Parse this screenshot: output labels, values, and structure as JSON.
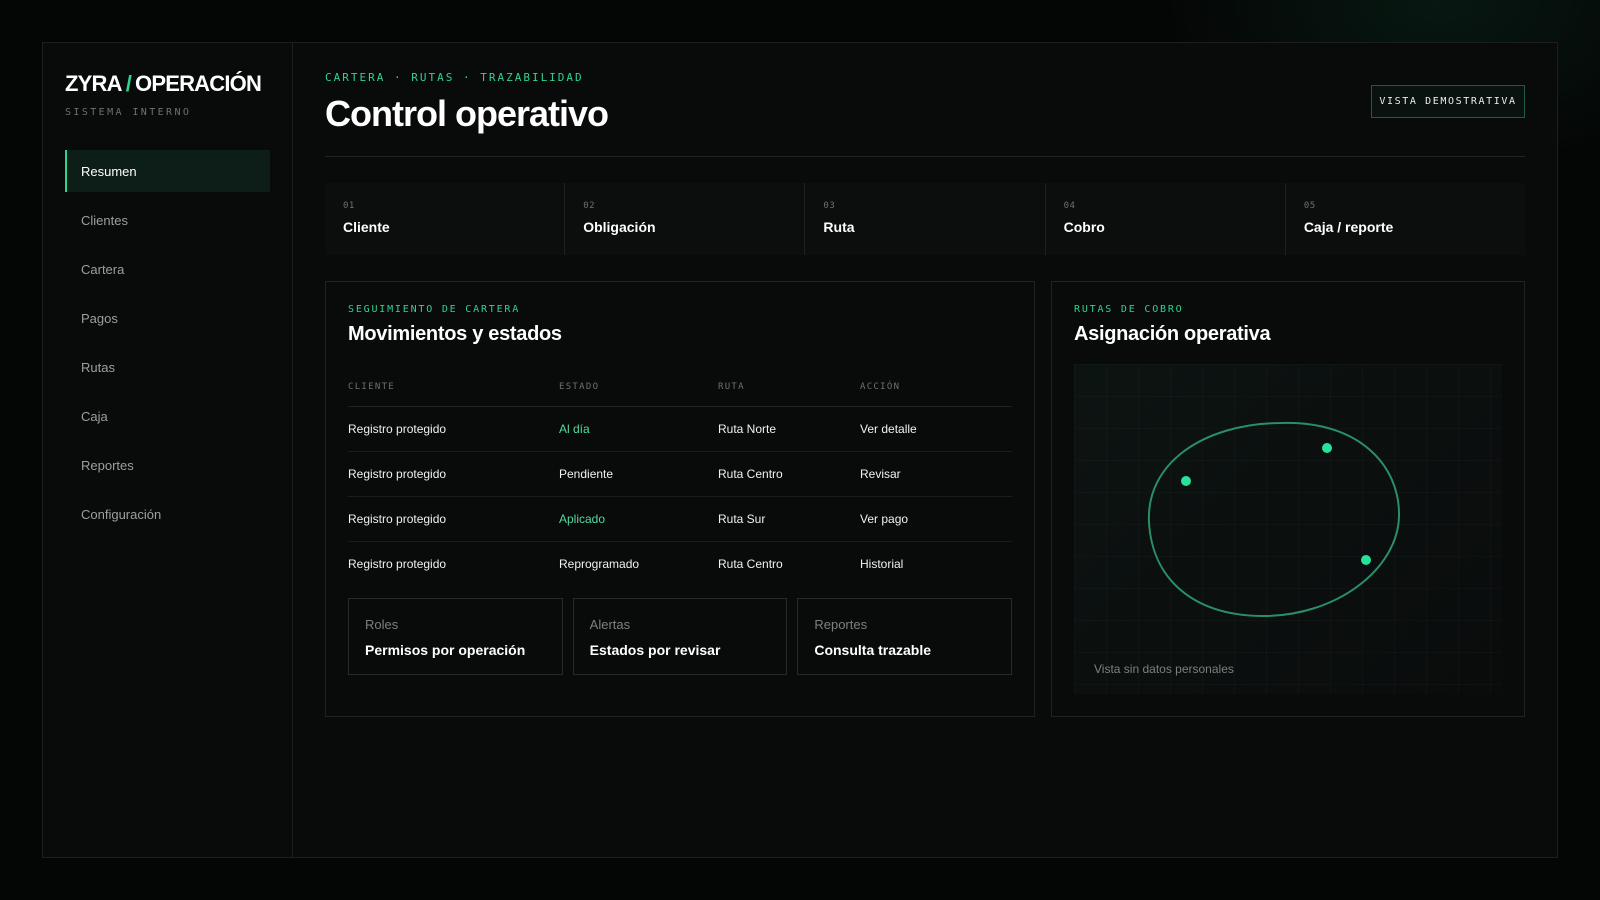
{
  "brand": {
    "name_left": "ZYRA",
    "slash": "/",
    "name_right": "OPERACIÓN",
    "subtitle": "SISTEMA INTERNO"
  },
  "sidebar": {
    "items": [
      {
        "label": "Resumen",
        "active": true
      },
      {
        "label": "Clientes"
      },
      {
        "label": "Cartera"
      },
      {
        "label": "Pagos"
      },
      {
        "label": "Rutas"
      },
      {
        "label": "Caja"
      },
      {
        "label": "Reportes"
      },
      {
        "label": "Configuración"
      }
    ]
  },
  "header": {
    "breadcrumb": "CARTERA · RUTAS · TRAZABILIDAD",
    "title": "Control operativo",
    "demo_button": "VISTA DEMOSTRATIVA"
  },
  "steps": [
    {
      "num": "01",
      "label": "Cliente"
    },
    {
      "num": "02",
      "label": "Obligación"
    },
    {
      "num": "03",
      "label": "Ruta"
    },
    {
      "num": "04",
      "label": "Cobro"
    },
    {
      "num": "05",
      "label": "Caja / reporte"
    }
  ],
  "tracking": {
    "eyebrow": "SEGUIMIENTO DE CARTERA",
    "title": "Movimientos y estados",
    "columns": [
      "CLIENTE",
      "ESTADO",
      "RUTA",
      "ACCIÓN"
    ],
    "rows": [
      {
        "client": "Registro protegido",
        "status": "Al día",
        "route": "Ruta Norte",
        "action": "Ver detalle"
      },
      {
        "client": "Registro protegido",
        "status": "Pendiente",
        "route": "Ruta Centro",
        "action": "Revisar"
      },
      {
        "client": "Registro protegido",
        "status": "Aplicado",
        "route": "Ruta Sur",
        "action": "Ver pago"
      },
      {
        "client": "Registro protegido",
        "status": "Reprogramado",
        "route": "Ruta Centro",
        "action": "Historial"
      }
    ],
    "cards": [
      {
        "label": "Roles",
        "value": "Permisos por operación"
      },
      {
        "label": "Alertas",
        "value": "Estados por revisar"
      },
      {
        "label": "Reportes",
        "value": "Consulta trazable"
      }
    ]
  },
  "routes": {
    "eyebrow": "RUTAS DE COBRO",
    "title": "Asignación operativa",
    "map_note": "Vista sin datos personales"
  },
  "colors": {
    "accent": "#2fd38f",
    "background": "#040505",
    "panel": "#090a0a"
  }
}
